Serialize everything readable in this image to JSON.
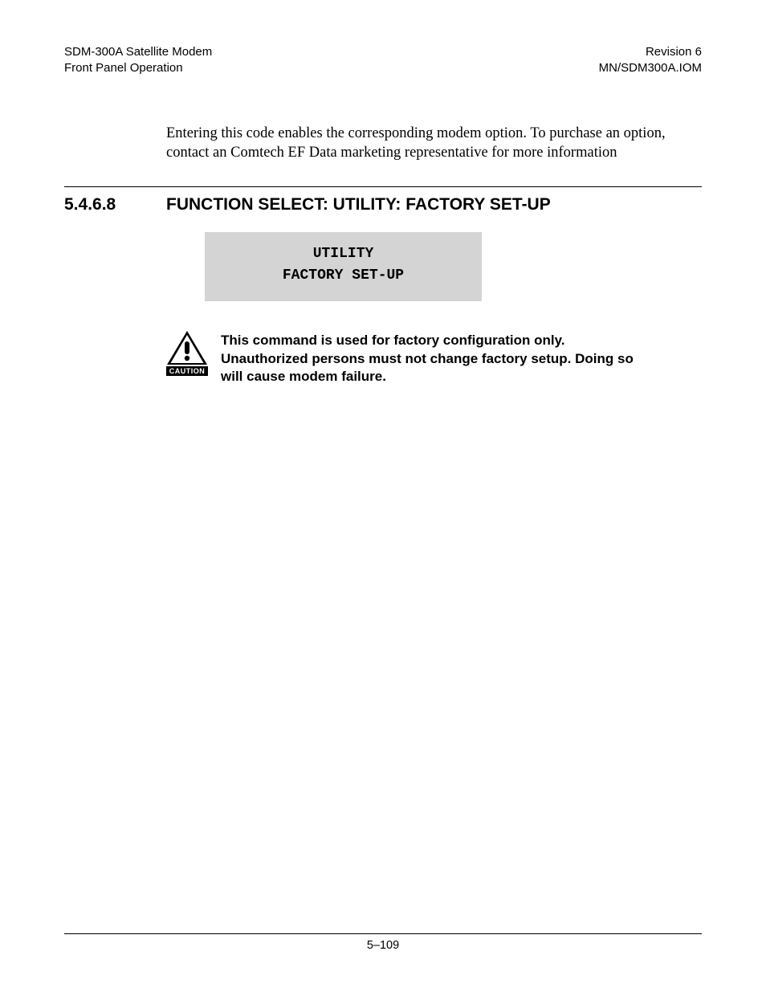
{
  "header": {
    "left_line1": "SDM-300A Satellite Modem",
    "left_line2": "Front Panel Operation",
    "right_line1": "Revision 6",
    "right_line2": "MN/SDM300A.IOM"
  },
  "intro_paragraph": "Entering this code enables the corresponding modem option. To purchase an option, contact an Comtech EF Data marketing representative for more information",
  "section": {
    "number": "5.4.6.8",
    "title": "FUNCTION SELECT: UTILITY: FACTORY SET-UP"
  },
  "display": {
    "line1": "UTILITY",
    "line2": "FACTORY SET-UP"
  },
  "caution": {
    "label": "CAUTION",
    "text": "This command is used for factory configuration only. Unauthorized persons must not change factory setup. Doing so will cause modem failure."
  },
  "footer": {
    "page_number": "5–109"
  }
}
